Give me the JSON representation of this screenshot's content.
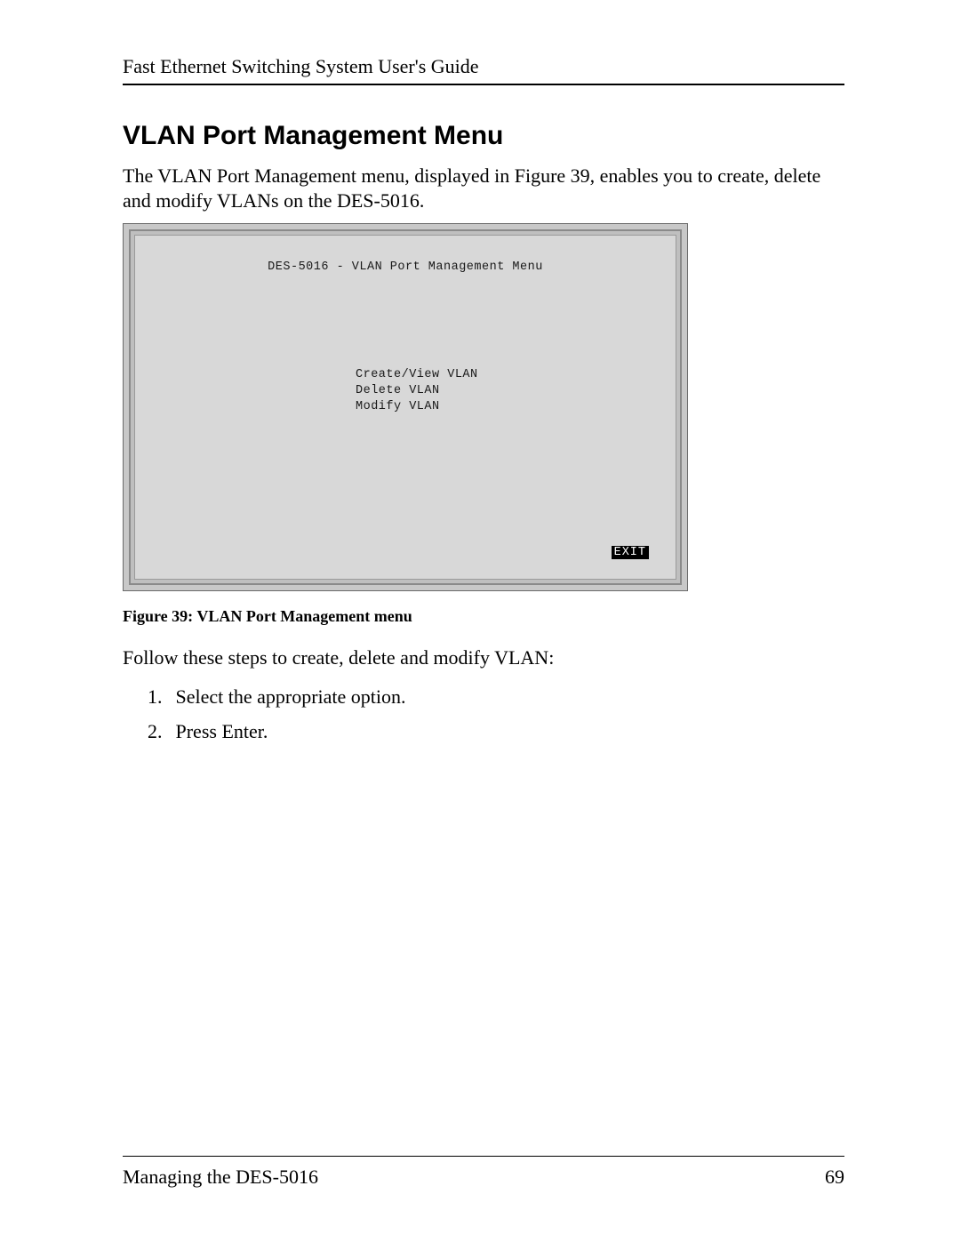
{
  "header": {
    "running_head": "Fast Ethernet Switching System User's Guide"
  },
  "section": {
    "title": "VLAN Port Management Menu",
    "intro": "The VLAN Port Management menu, displayed in Figure 39, enables you to create, delete and modify VLANs on the DES-5016."
  },
  "terminal": {
    "title": "DES-5016 - VLAN Port Management Menu",
    "menu_items": [
      "Create/View VLAN",
      "Delete VLAN",
      "Modify VLAN"
    ],
    "exit_label": "EXIT"
  },
  "figure_caption": "Figure 39: VLAN Port Management menu",
  "steps_intro": "Follow these steps to create, delete and modify VLAN:",
  "steps": [
    "Select the appropriate option.",
    "Press Enter."
  ],
  "footer": {
    "section_name": "Managing the DES-5016",
    "page_number": "69"
  }
}
